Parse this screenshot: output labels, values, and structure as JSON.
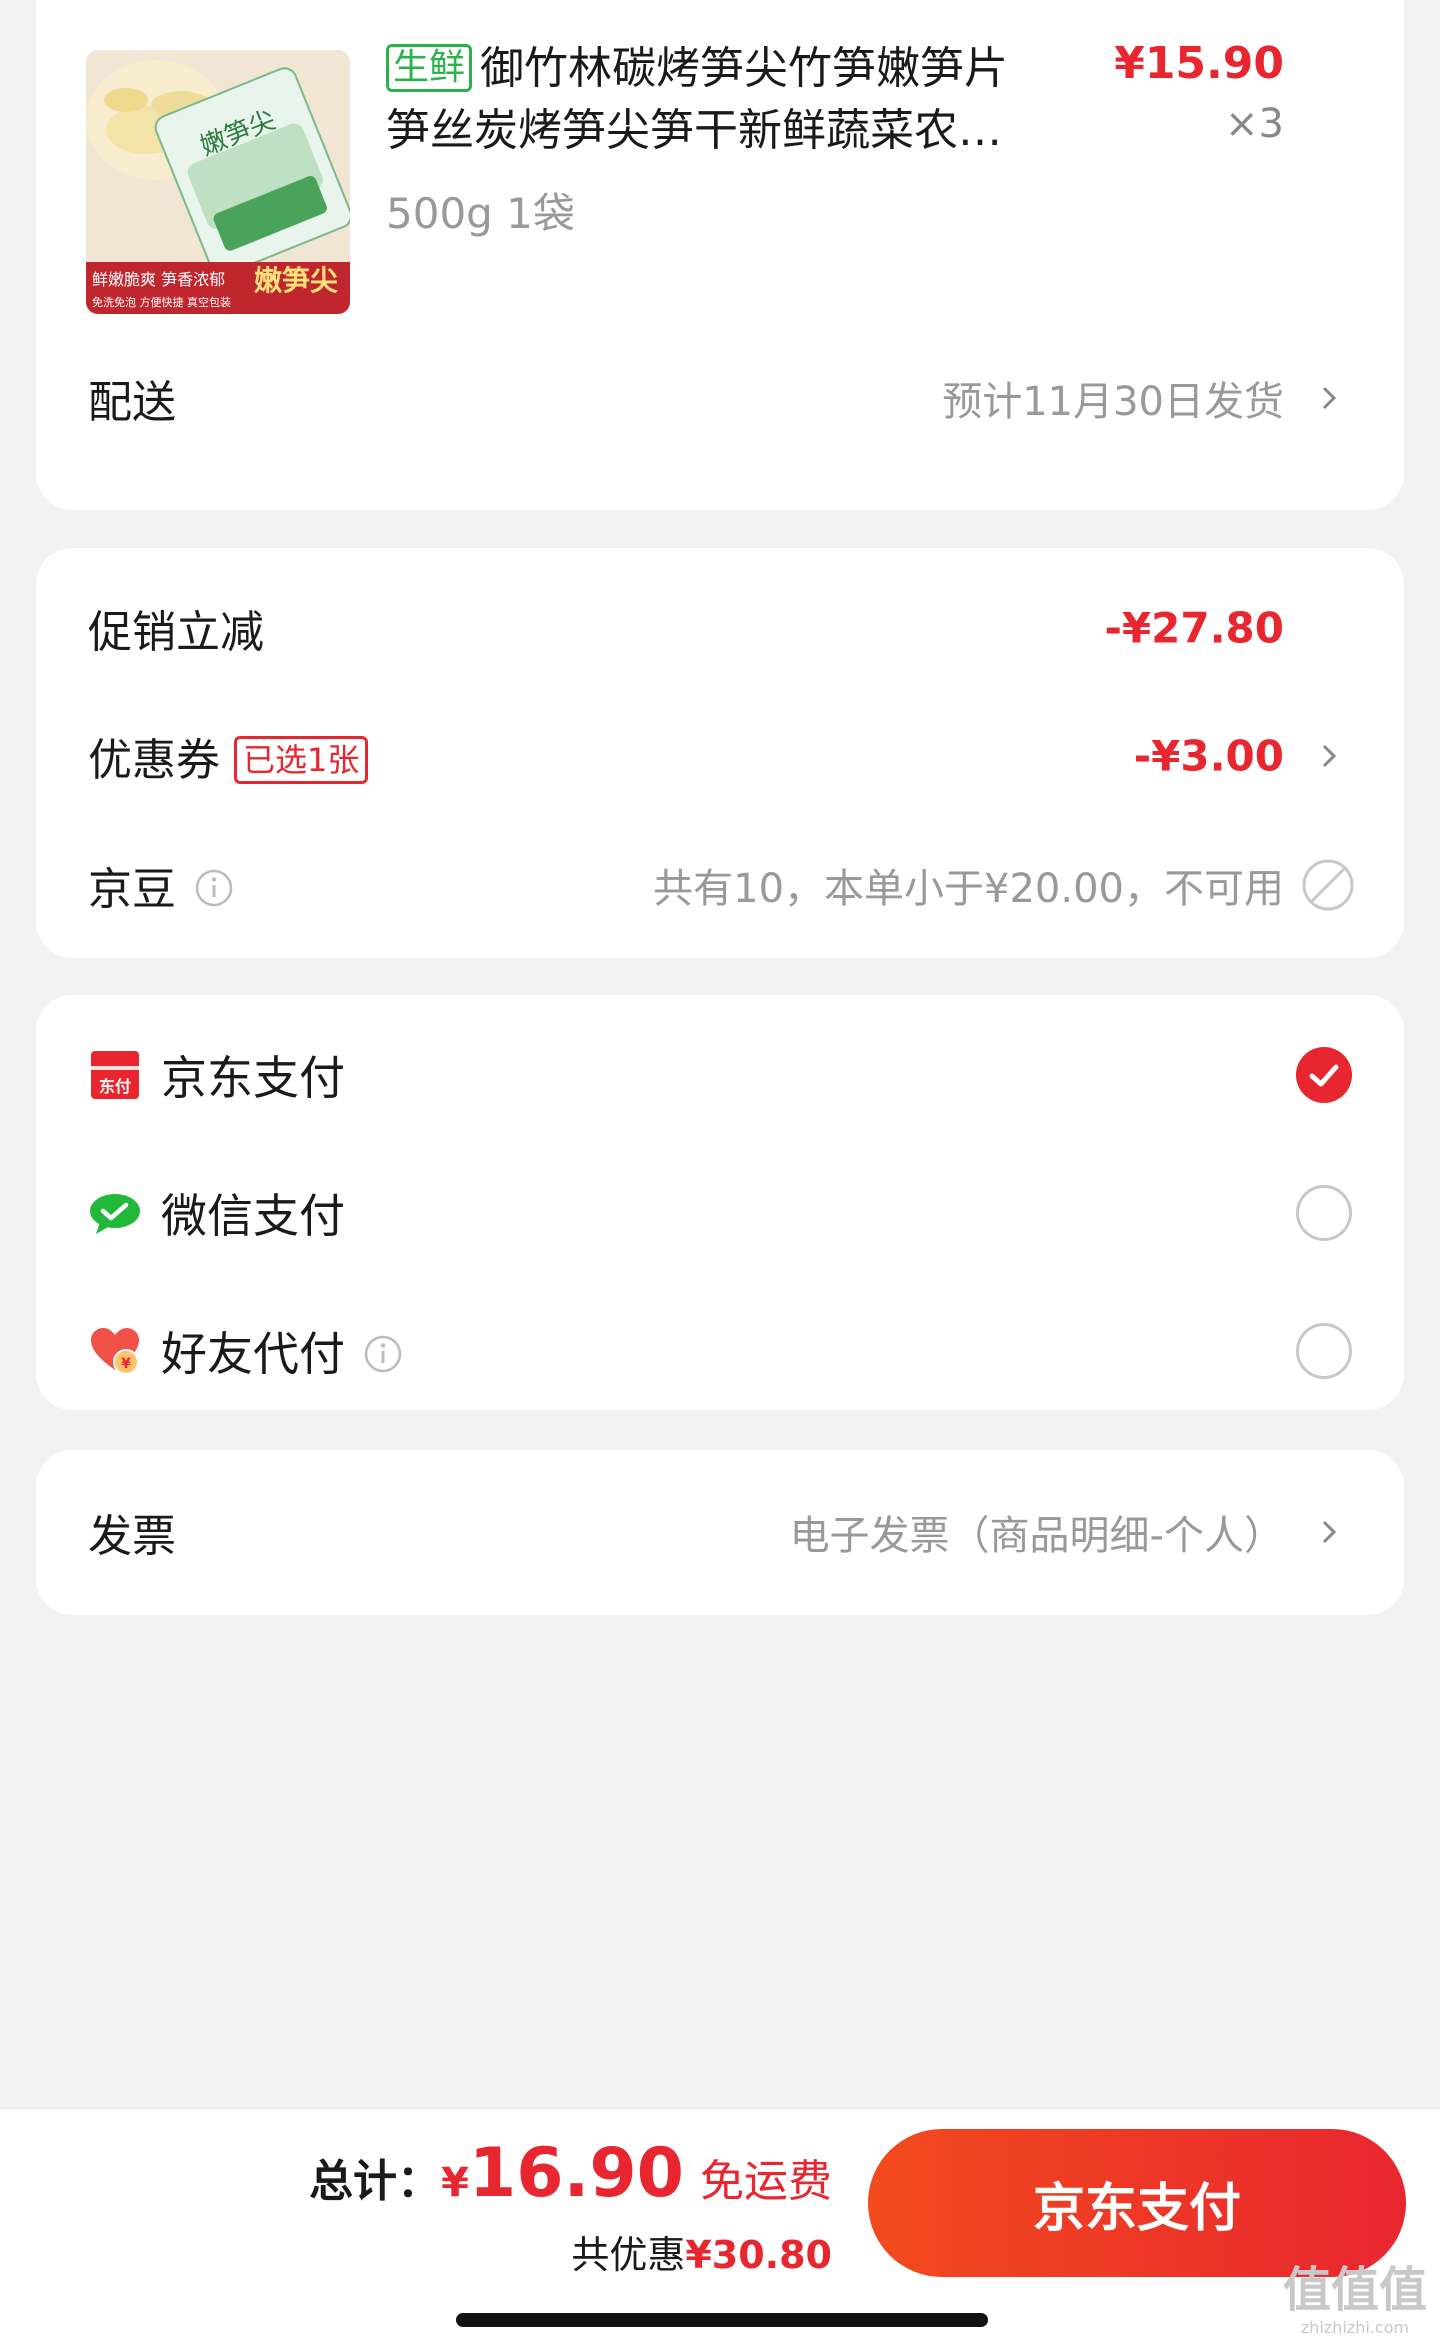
{
  "product": {
    "tag": "生鲜",
    "title_line1": "御竹林碳烤笋尖竹笋嫩笋片",
    "title_line2": "笋丝炭烤笋尖笋干新鲜蔬菜农…",
    "spec": "500g 1袋",
    "price": "¥15.90",
    "quantity": "×3",
    "image_caption": "鲜嫩脆爽 笋香浓郁",
    "image_title": "嫩笋尖",
    "image_footer": "免洗免泡 方便快捷 真空包装"
  },
  "delivery": {
    "label": "配送",
    "value": "预计11月30日发货"
  },
  "discounts": {
    "promo_label": "促销立减",
    "promo_value": "-¥27.80",
    "coupon_label": "优惠券",
    "coupon_tag": "已选1张",
    "coupon_value": "-¥3.00",
    "jd_bean_label": "京豆",
    "jd_bean_value": "共有10，本单小于¥20.00，不可用"
  },
  "payment": {
    "options": [
      {
        "label": "京东支付",
        "icon": "jd-pay-icon",
        "checked": true
      },
      {
        "label": "微信支付",
        "icon": "wechat-pay-icon",
        "checked": false
      },
      {
        "label": "好友代付",
        "icon": "friend-pay-icon",
        "checked": false
      }
    ],
    "jd_icon_text": "东付"
  },
  "invoice": {
    "label": "发票",
    "value": "电子发票（商品明细-个人）"
  },
  "bottom": {
    "total_label": "总计：",
    "currency": "¥",
    "total_amount": "16.90",
    "free_shipping": "免运费",
    "saved_label": "共优惠",
    "saved_amount": "¥30.80",
    "pay_button": "京东支付"
  },
  "watermark": {
    "main": "值值值",
    "sub": "zhizhizhi.com"
  },
  "colors": {
    "accent": "#e8262f",
    "fresh_tag": "#2bb24c",
    "background": "#f2f2f2"
  }
}
